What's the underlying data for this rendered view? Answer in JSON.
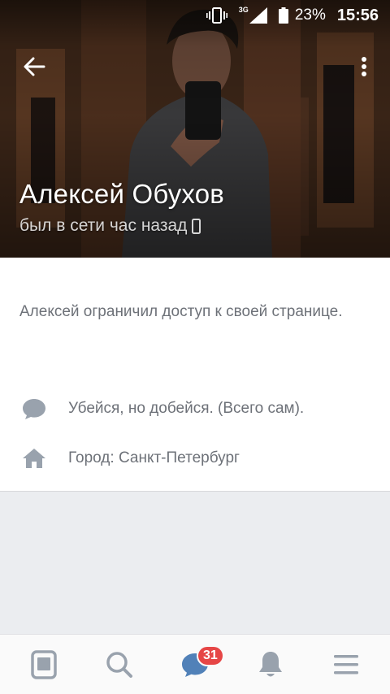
{
  "status_bar": {
    "network": "3G",
    "battery": "23%",
    "time": "15:56"
  },
  "profile": {
    "name": "Алексей Обухов",
    "last_seen": "был в сети час назад"
  },
  "private_notice": "Алексей ограничил доступ к своей странице.",
  "info": {
    "status_quote": "Убейся, но добейся. (Всего сам).",
    "city": "Город: Санкт-Петербург"
  },
  "bottom_nav": {
    "messages_badge": "31",
    "items": [
      "news-icon",
      "search-icon",
      "messages-icon",
      "notifications-icon",
      "menu-icon"
    ]
  },
  "colors": {
    "badge": "#e64646",
    "icon_gray": "#99a2ad",
    "messages_blue": "#5181b8"
  }
}
